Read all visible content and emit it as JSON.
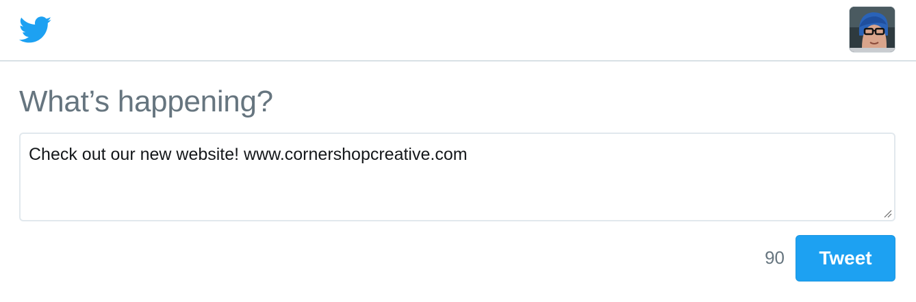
{
  "header": {
    "logo_icon": "twitter-bird-icon",
    "brand_color": "#1da1f2",
    "avatar_icon": "user-avatar"
  },
  "composer": {
    "heading": "What’s happening?",
    "text_value": "Check out our new website! www.cornershopcreative.com",
    "remaining_chars": "90",
    "tweet_label": "Tweet"
  },
  "colors": {
    "button_bg": "#1da1f2",
    "muted_text": "#66757f",
    "border": "#e1e8ed"
  }
}
